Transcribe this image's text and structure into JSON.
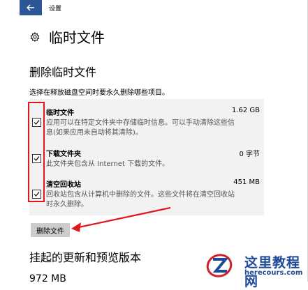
{
  "window": {
    "title": "设置"
  },
  "header": {
    "title": "临时文件",
    "icon": "gear-icon"
  },
  "section": {
    "title": "删除临时文件",
    "instruction": "选择在释放磁盘空间时要永久删除哪些项目。"
  },
  "items": [
    {
      "name": "临时文件",
      "size": "1.62 GB",
      "description_lines": [
        "应用可以在特定文件夹中存储临时信息。可以手动清除这些信",
        "息(如果应用未自动将其清除)。"
      ],
      "checked": true
    },
    {
      "name": "下载文件夹",
      "size": "0 字节",
      "description_lines": [
        "此文件夹包含从 Internet 下载的文件。"
      ],
      "checked": true
    },
    {
      "name": "清空回收站",
      "size": "451 MB",
      "description_lines": [
        "回收站包含从计算机中删除的文件。这些文件将在清空回收站",
        "时永久删除。"
      ],
      "checked": true
    }
  ],
  "delete_button": {
    "label": "删除文件"
  },
  "section2": {
    "title": "挂起的更新和预览版本",
    "size": "972 MB"
  },
  "watermark": {
    "name": "这里教程网",
    "site": "herecours.com"
  },
  "colors": {
    "back_button": "#2b5797",
    "highlight": "#e0181b",
    "panel": "#f2f2f2",
    "button": "#cccccc",
    "watermark": "#1e4a9a"
  }
}
